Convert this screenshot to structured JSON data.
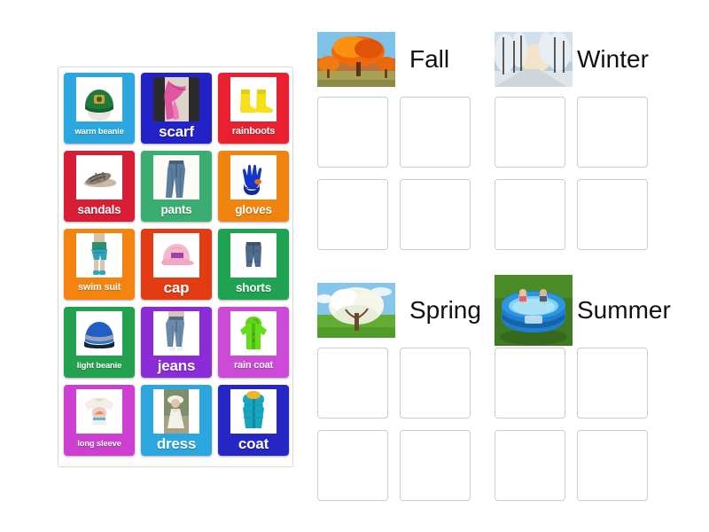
{
  "activity": {
    "type": "drag-and-drop-sorting",
    "title": "Seasons clothing sort"
  },
  "tray": {
    "name": "word-card-tray",
    "cards": [
      {
        "label": "warm beanie",
        "color": "#2ba6de",
        "icon": "green-beanie-hat",
        "size": "s9"
      },
      {
        "label": "scarf",
        "color": "#2222c8",
        "icon": "pink-scarf",
        "size": "s16"
      },
      {
        "label": "rainboots",
        "color": "#e8202f",
        "icon": "yellow-rainboots",
        "size": "s11"
      },
      {
        "label": "sandals",
        "color": "#d81e34",
        "icon": "sandal-shoe",
        "size": "s13"
      },
      {
        "label": "pants",
        "color": "#3aae70",
        "icon": "blue-jeans-pants",
        "size": "s13"
      },
      {
        "label": "gloves",
        "color": "#f0840f",
        "icon": "blue-gloves",
        "size": "s13"
      },
      {
        "label": "swim suit",
        "color": "#f4840f",
        "icon": "swim-trunks-kid",
        "size": "s11"
      },
      {
        "label": "cap",
        "color": "#e33c12",
        "icon": "pink-baseball-cap",
        "size": "s16"
      },
      {
        "label": "shorts",
        "color": "#1fa252",
        "icon": "denim-shorts",
        "size": "s13"
      },
      {
        "label": "light beanie",
        "color": "#23a14f",
        "icon": "striped-beanie",
        "size": "s9"
      },
      {
        "label": "jeans",
        "color": "#8c2bd8",
        "icon": "jeans-on-person",
        "size": "s16"
      },
      {
        "label": "rain coat",
        "color": "#cc4ad8",
        "icon": "green-rain-coat",
        "size": "s11"
      },
      {
        "label": "long sleeve",
        "color": "#cc3fd0",
        "icon": "long-sleeve-shirt",
        "size": "s9"
      },
      {
        "label": "dress",
        "color": "#2ba6de",
        "icon": "girl-in-dress",
        "size": "s16"
      },
      {
        "label": "coat",
        "color": "#2626c4",
        "icon": "teal-puffer-coat",
        "size": "s16"
      }
    ]
  },
  "board": {
    "name": "season-drop-board",
    "slots_per_season": 4,
    "groups": [
      {
        "key": "fall",
        "label": "Fall",
        "photo": "autumn-orange-tree"
      },
      {
        "key": "winter",
        "label": "Winter",
        "photo": "snowy-forest-road"
      },
      {
        "key": "spring",
        "label": "Spring",
        "photo": "blossoming-white-tree"
      },
      {
        "key": "summer",
        "label": "Summer",
        "photo": "kids-in-paddling-pool"
      }
    ]
  }
}
